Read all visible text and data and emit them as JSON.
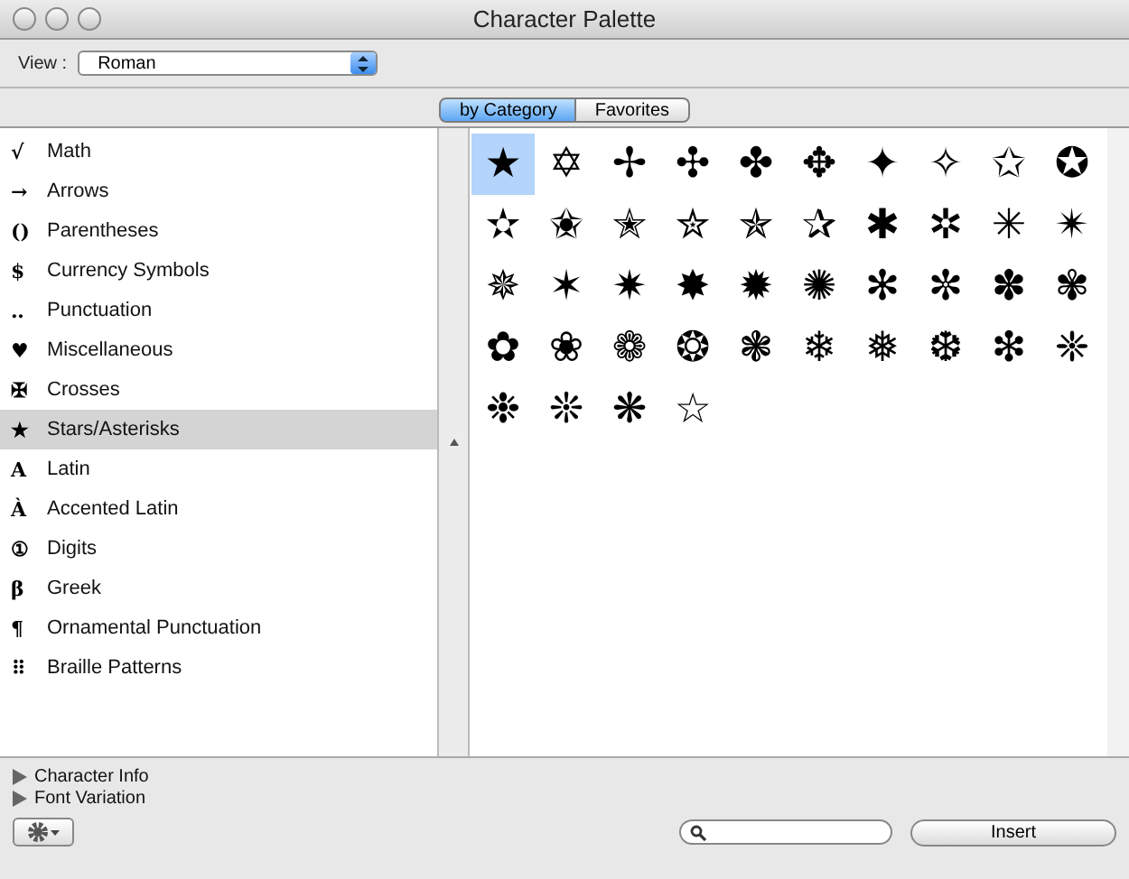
{
  "window": {
    "title": "Character Palette"
  },
  "view": {
    "label": "View :",
    "value": "Roman"
  },
  "tabs": [
    {
      "label": "by Category",
      "selected": true
    },
    {
      "label": "Favorites",
      "selected": false
    }
  ],
  "categories": [
    {
      "icon": "√",
      "label": "Math",
      "selected": false
    },
    {
      "icon": "→",
      "label": "Arrows",
      "selected": false
    },
    {
      "icon": "()",
      "label": "Parentheses",
      "selected": false
    },
    {
      "icon": "$",
      "label": "Currency Symbols",
      "selected": false
    },
    {
      "icon": "‥",
      "label": "Punctuation",
      "selected": false
    },
    {
      "icon": "♥",
      "label": "Miscellaneous",
      "selected": false
    },
    {
      "icon": "✠",
      "label": "Crosses",
      "selected": false
    },
    {
      "icon": "★",
      "label": "Stars/Asterisks",
      "selected": true
    },
    {
      "icon": "A",
      "label": "Latin",
      "selected": false
    },
    {
      "icon": "À",
      "label": "Accented Latin",
      "selected": false
    },
    {
      "icon": "①",
      "label": "Digits",
      "selected": false
    },
    {
      "icon": "β",
      "label": "Greek",
      "selected": false
    },
    {
      "icon": "¶",
      "label": "Ornamental Punctuation",
      "selected": false
    },
    {
      "icon": "⠿",
      "label": "Braille Patterns",
      "selected": false
    }
  ],
  "characters": [
    {
      "char": "★",
      "selected": true
    },
    {
      "char": "✡",
      "selected": false
    },
    {
      "char": "✢",
      "selected": false
    },
    {
      "char": "✣",
      "selected": false
    },
    {
      "char": "✤",
      "selected": false
    },
    {
      "char": "✥",
      "selected": false
    },
    {
      "char": "✦",
      "selected": false
    },
    {
      "char": "✧",
      "selected": false
    },
    {
      "char": "✩",
      "selected": false
    },
    {
      "char": "✪",
      "selected": false
    },
    {
      "char": "✫",
      "selected": false
    },
    {
      "char": "✬",
      "selected": false
    },
    {
      "char": "✭",
      "selected": false
    },
    {
      "char": "✮",
      "selected": false
    },
    {
      "char": "✯",
      "selected": false
    },
    {
      "char": "✰",
      "selected": false
    },
    {
      "char": "✱",
      "selected": false
    },
    {
      "char": "✲",
      "selected": false
    },
    {
      "char": "✳",
      "selected": false
    },
    {
      "char": "✴",
      "selected": false
    },
    {
      "char": "✵",
      "selected": false
    },
    {
      "char": "✶",
      "selected": false
    },
    {
      "char": "✷",
      "selected": false
    },
    {
      "char": "✸",
      "selected": false
    },
    {
      "char": "✹",
      "selected": false
    },
    {
      "char": "✺",
      "selected": false
    },
    {
      "char": "✻",
      "selected": false
    },
    {
      "char": "✼",
      "selected": false
    },
    {
      "char": "✽",
      "selected": false
    },
    {
      "char": "✾",
      "selected": false
    },
    {
      "char": "✿",
      "selected": false
    },
    {
      "char": "❀",
      "selected": false
    },
    {
      "char": "❁",
      "selected": false
    },
    {
      "char": "❂",
      "selected": false
    },
    {
      "char": "❃",
      "selected": false
    },
    {
      "char": "❄",
      "selected": false
    },
    {
      "char": "❅",
      "selected": false
    },
    {
      "char": "❆",
      "selected": false
    },
    {
      "char": "❇",
      "selected": false
    },
    {
      "char": "❈",
      "selected": false
    },
    {
      "char": "❉",
      "selected": false
    },
    {
      "char": "❊",
      "selected": false
    },
    {
      "char": "❋",
      "selected": false
    },
    {
      "char": "☆",
      "selected": false
    }
  ],
  "disclosures": [
    {
      "label": "Character Info",
      "expanded": false
    },
    {
      "label": "Font Variation",
      "expanded": false
    }
  ],
  "insert_button": "Insert"
}
